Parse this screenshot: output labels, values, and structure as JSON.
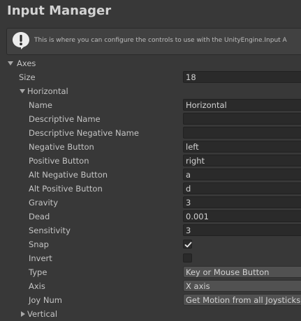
{
  "window": {
    "title": "Input Manager"
  },
  "info": {
    "text": "This is where you can configure the controls to use with the UnityEngine.Input A",
    "icon": "warning-exclamation-icon"
  },
  "axes": {
    "label": "Axes",
    "size_label": "Size",
    "size_value": "18",
    "horizontal": {
      "label": "Horizontal",
      "name_label": "Name",
      "name_value": "Horizontal",
      "descriptive_name_label": "Descriptive Name",
      "descriptive_name_value": "",
      "descriptive_negative_name_label": "Descriptive Negative Name",
      "descriptive_negative_name_value": "",
      "negative_button_label": "Negative Button",
      "negative_button_value": "left",
      "positive_button_label": "Positive Button",
      "positive_button_value": "right",
      "alt_negative_button_label": "Alt Negative Button",
      "alt_negative_button_value": "a",
      "alt_positive_button_label": "Alt Positive Button",
      "alt_positive_button_value": "d",
      "gravity_label": "Gravity",
      "gravity_value": "3",
      "dead_label": "Dead",
      "dead_value": "0.001",
      "sensitivity_label": "Sensitivity",
      "sensitivity_value": "3",
      "snap_label": "Snap",
      "snap_checked": true,
      "invert_label": "Invert",
      "invert_checked": false,
      "type_label": "Type",
      "type_value": "Key or Mouse Button",
      "axis_label": "Axis",
      "axis_value": "X axis",
      "joy_num_label": "Joy Num",
      "joy_num_value": "Get Motion from all Joysticks"
    },
    "vertical": {
      "label": "Vertical"
    }
  },
  "colors": {
    "background": "#383838",
    "field": "#2a2a2a",
    "dropdown": "#515151",
    "text": "#c4c4c4"
  }
}
